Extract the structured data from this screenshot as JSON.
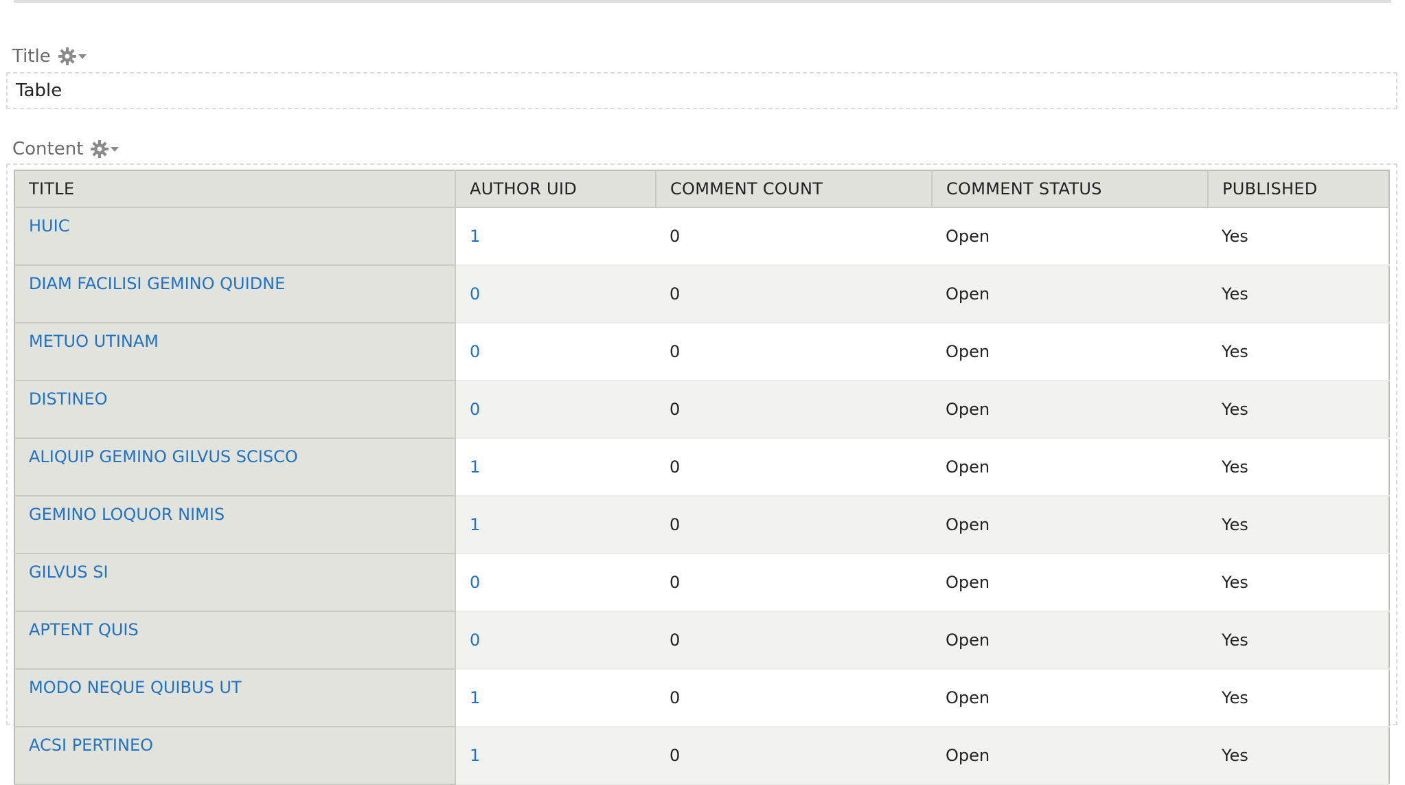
{
  "title_region": {
    "label": "Title",
    "value": "Table"
  },
  "content_region": {
    "label": "Content"
  },
  "icons": {
    "region_settings": "gear-icon",
    "dropdown": "caret-down-icon"
  },
  "colors": {
    "link": "#1f72c4",
    "header_bg": "#e2e2dc",
    "title_column_bg": "#e3e3dd",
    "stripe_bg": "#f2f2ee"
  },
  "table": {
    "headers": [
      "TITLE",
      "AUTHOR UID",
      "COMMENT COUNT",
      "COMMENT STATUS",
      "PUBLISHED"
    ],
    "rows": [
      {
        "title": "HUIC",
        "author_uid": "1",
        "comment_count": "0",
        "comment_status": "Open",
        "published": "Yes"
      },
      {
        "title": "DIAM FACILISI GEMINO QUIDNE",
        "author_uid": "0",
        "comment_count": "0",
        "comment_status": "Open",
        "published": "Yes"
      },
      {
        "title": "METUO UTINAM",
        "author_uid": "0",
        "comment_count": "0",
        "comment_status": "Open",
        "published": "Yes"
      },
      {
        "title": "DISTINEO",
        "author_uid": "0",
        "comment_count": "0",
        "comment_status": "Open",
        "published": "Yes"
      },
      {
        "title": "ALIQUIP GEMINO GILVUS SCISCO",
        "author_uid": "1",
        "comment_count": "0",
        "comment_status": "Open",
        "published": "Yes"
      },
      {
        "title": "GEMINO LOQUOR NIMIS",
        "author_uid": "1",
        "comment_count": "0",
        "comment_status": "Open",
        "published": "Yes"
      },
      {
        "title": "GILVUS SI",
        "author_uid": "0",
        "comment_count": "0",
        "comment_status": "Open",
        "published": "Yes"
      },
      {
        "title": "APTENT QUIS",
        "author_uid": "0",
        "comment_count": "0",
        "comment_status": "Open",
        "published": "Yes"
      },
      {
        "title": "MODO NEQUE QUIBUS UT",
        "author_uid": "1",
        "comment_count": "0",
        "comment_status": "Open",
        "published": "Yes"
      },
      {
        "title": "ACSI PERTINEO",
        "author_uid": "1",
        "comment_count": "0",
        "comment_status": "Open",
        "published": "Yes"
      }
    ]
  }
}
